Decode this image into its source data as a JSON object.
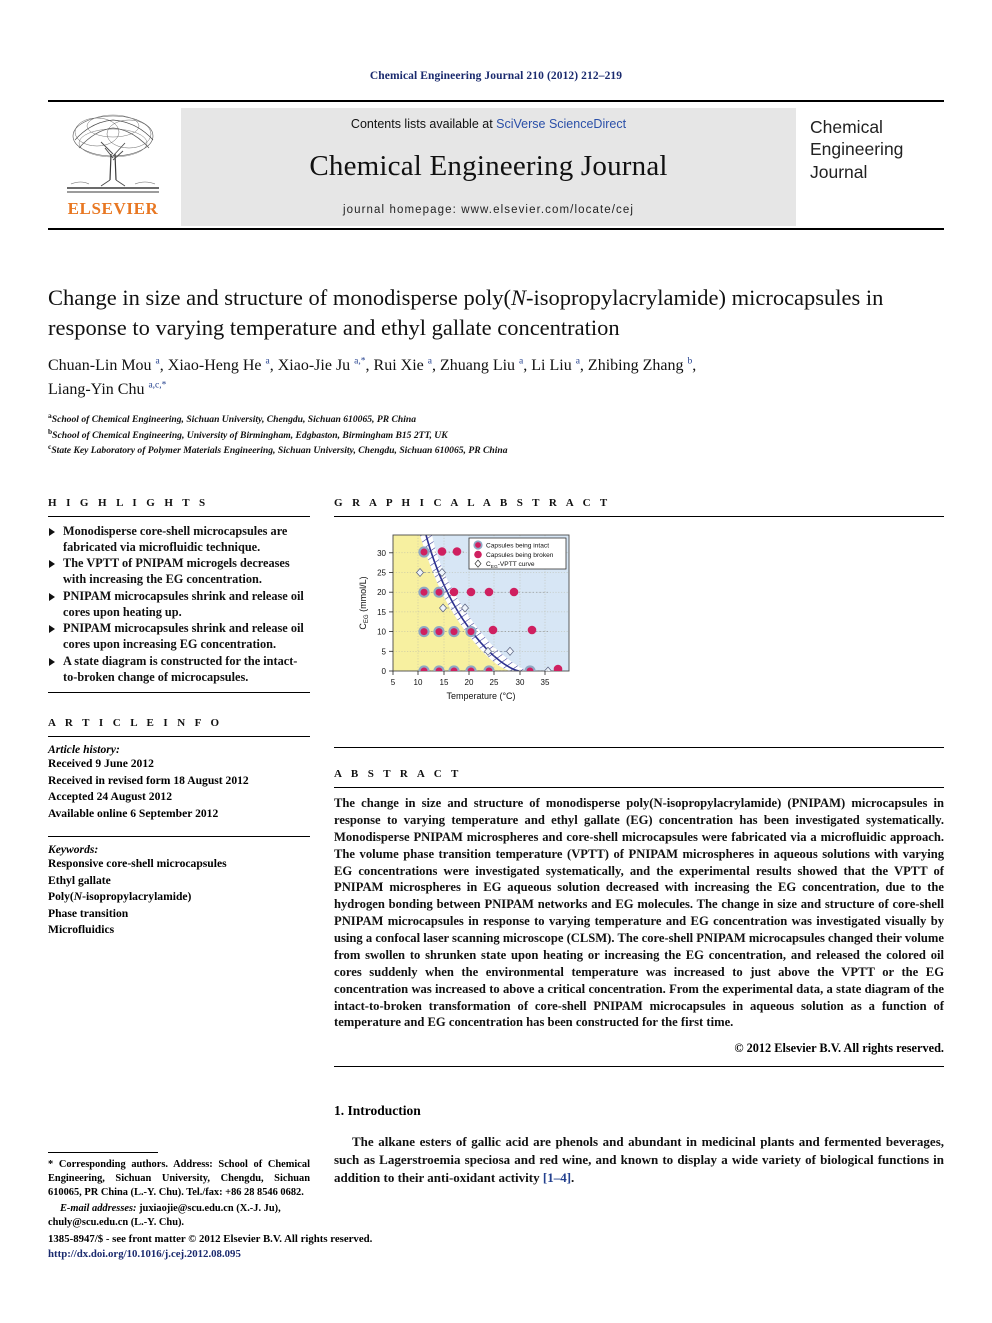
{
  "running_head": "Chemical Engineering Journal 210 (2012) 212–219",
  "masthead": {
    "contents_prefix": "Contents lists available at ",
    "sciencedirect": "SciVerse ScienceDirect",
    "journal_title": "Chemical Engineering Journal",
    "homepage": "journal homepage: www.elsevier.com/locate/cej",
    "publisher": "ELSEVIER",
    "cover_line1": "Chemical",
    "cover_line2": "Engineering",
    "cover_line3": "Journal"
  },
  "article": {
    "title_part1": "Change in size and structure of monodisperse poly(",
    "title_italic": "N",
    "title_part2": "-isopropylacrylamide) microcapsules in response to varying temperature and ethyl gallate concentration",
    "authors_html": "Chuan-Lin Mou a, Xiao-Heng He a, Xiao-Jie Ju a,*, Rui Xie a, Zhuang Liu a, Li Liu a, Zhibing Zhang b, Liang-Yin Chu a,c,*",
    "affiliations": [
      "School of Chemical Engineering, Sichuan University, Chengdu, Sichuan 610065, PR China",
      "School of Chemical Engineering, University of Birmingham, Edgbaston, Birmingham B15 2TT, UK",
      "State Key Laboratory of Polymer Materials Engineering, Sichuan University, Chengdu, Sichuan 610065, PR China"
    ],
    "affiliation_markers": [
      "a",
      "b",
      "c"
    ]
  },
  "highlights": {
    "heading": "H I G H L I G H T S",
    "items": [
      "Monodisperse core-shell microcapsules are fabricated via microfluidic technique.",
      "The VPTT of PNIPAM microgels decreases with increasing the EG concentration.",
      "PNIPAM microcapsules shrink and release oil cores upon heating up.",
      "PNIPAM microcapsules shrink and release oil cores upon increasing EG concentration.",
      "A state diagram is constructed for the intact-to-broken change of microcapsules."
    ]
  },
  "graphical_abstract": {
    "heading": "G R A P H I C A L   A B S T R A C T"
  },
  "article_info": {
    "heading": "A R T I C L E   I N F O",
    "history_label": "Article history:",
    "history": [
      "Received 9 June 2012",
      "Received in revised form 18 August 2012",
      "Accepted 24 August 2012",
      "Available online 6 September 2012"
    ],
    "keywords_label": "Keywords:",
    "keywords": [
      "Responsive core-shell microcapsules",
      "Ethyl gallate",
      "Poly(N-isopropylacrylamide)",
      "Phase transition",
      "Microfluidics"
    ]
  },
  "abstract": {
    "heading": "A B S T R A C T",
    "text": "The change in size and structure of monodisperse poly(N-isopropylacrylamide) (PNIPAM) microcapsules in response to varying temperature and ethyl gallate (EG) concentration has been investigated systematically. Monodisperse PNIPAM microspheres and core-shell microcapsules were fabricated via a microfluidic approach. The volume phase transition temperature (VPTT) of PNIPAM microspheres in aqueous solutions with varying EG concentrations were investigated systematically, and the experimental results showed that the VPTT of PNIPAM microspheres in EG aqueous solution decreased with increasing the EG concentration, due to the hydrogen bonding between PNIPAM networks and EG molecules. The change in size and structure of core-shell PNIPAM microcapsules in response to varying temperature and EG concentration was investigated visually by using a confocal laser scanning microscope (CLSM). The core-shell PNIPAM microcapsules changed their volume from swollen to shrunken state upon heating or increasing the EG concentration, and released the colored oil cores suddenly when the environmental temperature was increased to just above the VPTT or the EG concentration was increased to above a critical concentration. From the experimental data, a state diagram of the intact-to-broken transformation of core-shell PNIPAM microcapsules in aqueous solution as a function of temperature and EG concentration has been constructed for the first time.",
    "copyright": "© 2012 Elsevier B.V. All rights reserved."
  },
  "introduction": {
    "heading": "1. Introduction",
    "paragraph": "The alkane esters of gallic acid are phenols and abundant in medicinal plants and fermented beverages, such as Lagerstroemia speciosa and red wine, and known to display a wide variety of biological functions in addition to their anti-oxidant activity ",
    "reference": "[1–4]",
    "tail": "."
  },
  "footnotes": {
    "corresponding": "* Corresponding authors. Address: School of Chemical Engineering, Sichuan University, Chengdu, Sichuan 610065, PR China (L.-Y. Chu). Tel./fax: +86 28 8546 0682.",
    "email_label": "E-mail addresses:",
    "email1": "juxiaojie@scu.edu.cn",
    "email1_who": "(X.-J. Ju),",
    "email2": "chuly@scu.edu.cn",
    "email2_who": "(L.-Y. Chu)."
  },
  "imprint": {
    "line1": "1385-8947/$ - see front matter © 2012 Elsevier B.V. All rights reserved.",
    "doi": "http://dx.doi.org/10.1016/j.cej.2012.08.095"
  },
  "colors": {
    "link_blue": "#23408e",
    "elsevier_orange": "#E87722",
    "region_intact": "#f7f0a0",
    "region_broken": "#d7e6f5",
    "curve_blue": "#2b2f8f",
    "marker_fill": "#cf2060",
    "marker_ring": "#6f8fb5",
    "masthead_gray": "#e6e6e6"
  },
  "chart_data": {
    "type": "scatter",
    "title": "",
    "xlabel": "Temperature (°C)",
    "ylabel": "CEG (mmol/L)",
    "xlim": [
      4,
      38
    ],
    "ylim": [
      -1.5,
      34
    ],
    "xticks": [
      5,
      10,
      15,
      20,
      25,
      30,
      35
    ],
    "yticks": [
      0,
      5,
      10,
      15,
      20,
      25,
      30
    ],
    "grid": true,
    "legend_position": "top-right",
    "legend": [
      "Capsules being intact",
      "Capsules being broken",
      "CEG-VPTT curve"
    ],
    "series": [
      {
        "name": "Capsules being intact",
        "marker": "ringed-circle",
        "points": [
          [
            11.0,
            30.2
          ],
          [
            11.0,
            20.1
          ],
          [
            14.0,
            20.1
          ],
          [
            11.0,
            10.2
          ],
          [
            14.0,
            10.2
          ],
          [
            17.0,
            10.2
          ],
          [
            20.4,
            10.2
          ],
          [
            11.0,
            0.2
          ],
          [
            14.0,
            0.2
          ],
          [
            17.0,
            0.2
          ],
          [
            20.4,
            0.2
          ],
          [
            24.0,
            0.2
          ],
          [
            32.0,
            0.2
          ]
        ]
      },
      {
        "name": "Capsules being broken",
        "marker": "circle",
        "points": [
          [
            14.7,
            30.4
          ],
          [
            17.6,
            30.4
          ],
          [
            17.1,
            20.3
          ],
          [
            20.4,
            20.3
          ],
          [
            24.0,
            20.3
          ],
          [
            28.9,
            20.3
          ],
          [
            24.8,
            10.5
          ],
          [
            32.5,
            10.5
          ],
          [
            36.4,
            0.4
          ]
        ]
      },
      {
        "name": "CEG-VPTT curve",
        "marker": "open-diamond",
        "points": [
          [
            10.4,
            25.0
          ],
          [
            14.6,
            25.0
          ],
          [
            15.0,
            16.0
          ],
          [
            19.0,
            16.0
          ],
          [
            24.0,
            5.0
          ],
          [
            28.5,
            5.0
          ],
          [
            35.6,
            0.0
          ]
        ],
        "curve": [
          [
            10.3,
            33.8
          ],
          [
            11.5,
            30.0
          ],
          [
            13.0,
            26.0
          ],
          [
            14.6,
            22.5
          ],
          [
            16.5,
            19.0
          ],
          [
            18.6,
            16.0
          ],
          [
            21.0,
            13.0
          ],
          [
            23.6,
            10.2
          ],
          [
            26.5,
            7.4
          ],
          [
            29.5,
            5.0
          ],
          [
            32.5,
            2.6
          ],
          [
            35.6,
            0.2
          ]
        ]
      }
    ],
    "regions": [
      {
        "name": "intact region",
        "color": "#f7f0a0",
        "side": "lower-left"
      },
      {
        "name": "broken region",
        "color": "#d7e6f5",
        "side": "upper-right"
      },
      {
        "name": "transition band",
        "hatched": true
      }
    ]
  }
}
